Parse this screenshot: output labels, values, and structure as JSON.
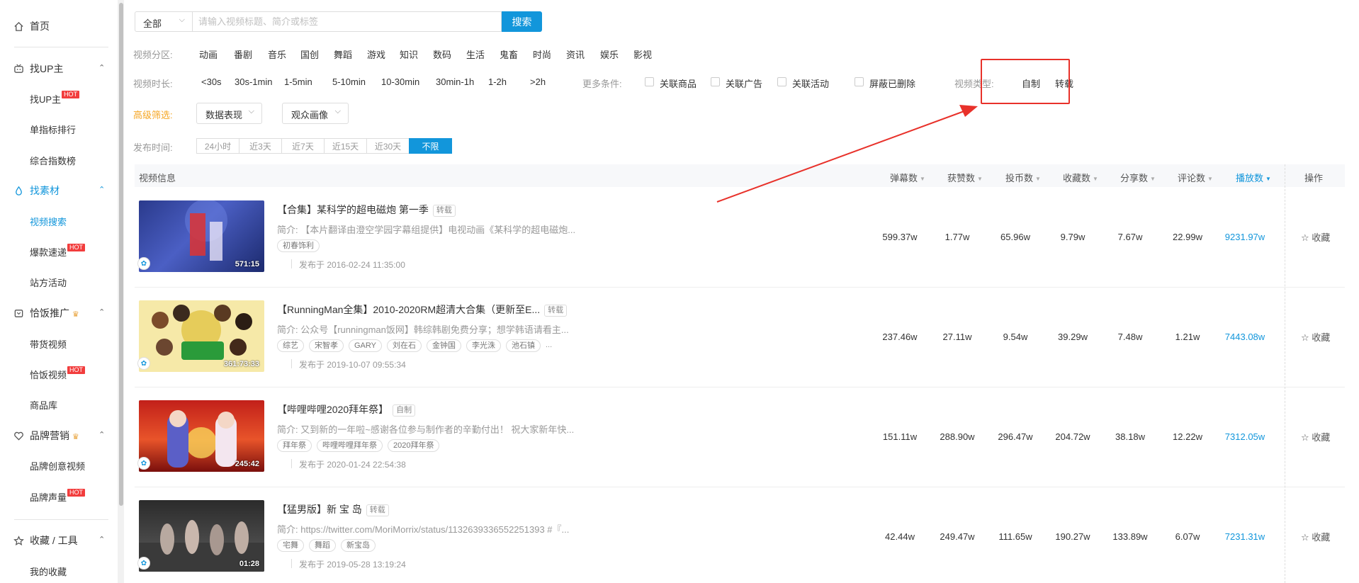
{
  "sidebar": {
    "home": "首页",
    "groups": [
      {
        "label": "找UP主",
        "items": [
          {
            "label": "找UP主",
            "hot": "HOT"
          },
          {
            "label": "单指标排行"
          },
          {
            "label": "综合指数榜"
          }
        ]
      },
      {
        "label": "找素材",
        "items": [
          {
            "label": "视频搜索"
          },
          {
            "label": "爆款速递",
            "hot": "HOT"
          },
          {
            "label": "站方活动"
          }
        ]
      },
      {
        "label": "恰饭推广",
        "items": [
          {
            "label": "带货视频"
          },
          {
            "label": "恰饭视频",
            "hot": "HOT"
          },
          {
            "label": "商品库"
          }
        ]
      },
      {
        "label": "品牌营销",
        "items": [
          {
            "label": "品牌创意视频"
          },
          {
            "label": "品牌声量",
            "hot": "HOT"
          }
        ]
      },
      {
        "label": "收藏 / 工具",
        "items": [
          {
            "label": "我的收藏"
          }
        ]
      }
    ]
  },
  "search": {
    "scope": "全部",
    "placeholder": "请输入视频标题、简介或标签",
    "button": "搜索"
  },
  "filters": {
    "category_label": "视频分区:",
    "categories": [
      "动画",
      "番剧",
      "音乐",
      "国创",
      "舞蹈",
      "游戏",
      "知识",
      "数码",
      "生活",
      "鬼畜",
      "时尚",
      "资讯",
      "娱乐",
      "影视"
    ],
    "duration_label": "视频时长:",
    "durations": [
      "<30s",
      "30s-1min",
      "1-5min",
      "5-10min",
      "10-30min",
      "30min-1h",
      "1-2h",
      ">2h"
    ],
    "more_label": "更多条件:",
    "more_options": [
      "关联商品",
      "关联广告",
      "关联活动",
      "屏蔽已删除"
    ],
    "type_label": "视频类型:",
    "types": [
      "自制",
      "转载"
    ],
    "advanced_label": "高级筛选:",
    "advanced_dropdowns": [
      "数据表现",
      "观众画像"
    ],
    "time_label": "发布时间:",
    "time_options": [
      "24小时",
      "近3天",
      "近7天",
      "近15天",
      "近30天",
      "不限"
    ],
    "time_selected": "不限"
  },
  "table": {
    "headers": {
      "info": "视频信息",
      "danmaku": "弹幕数",
      "likes": "获赞数",
      "coins": "投币数",
      "favorites": "收藏数",
      "shares": "分享数",
      "comments": "评论数",
      "plays": "播放数",
      "actions": "操作"
    },
    "fav_label": "收藏",
    "rows": [
      {
        "title": "【合集】某科学的超电磁炮 第一季",
        "tag": "转载",
        "desc": "简介: 【本片翻译由澄空学园字幕组提供】电视动画《某科学的超电磁炮...",
        "chips": [
          "初春饰利"
        ],
        "date": "发布于 2016-02-24 11:35:00",
        "duration": "571:15",
        "danmaku": "599.37w",
        "likes": "1.77w",
        "coins": "65.96w",
        "favorites": "9.79w",
        "shares": "7.67w",
        "comments": "22.99w",
        "plays": "9231.97w"
      },
      {
        "title": "【RunningMan全集】2010-2020RM超清大合集（更新至E...",
        "tag": "转载",
        "desc": "简介: 公众号【runningman饭网】韩综韩剧免费分享；想学韩语请看主...",
        "chips": [
          "综艺",
          "宋智孝",
          "GARY",
          "刘在石",
          "金钟国",
          "李光洙",
          "池石镇"
        ],
        "more": "...",
        "date": "发布于 2019-10-07 09:55:34",
        "duration": "361:73:33",
        "danmaku": "237.46w",
        "likes": "27.11w",
        "coins": "9.54w",
        "favorites": "39.29w",
        "shares": "7.48w",
        "comments": "1.21w",
        "plays": "7443.08w"
      },
      {
        "title": "【哔哩哔哩2020拜年祭】",
        "tag": "自制",
        "desc": "简介: 又到新的一年啦~感谢各位参与制作者的辛勤付出！ 祝大家新年快...",
        "chips": [
          "拜年祭",
          "哔哩哔哩拜年祭",
          "2020拜年祭"
        ],
        "date": "发布于 2020-01-24 22:54:38",
        "duration": "245:42",
        "danmaku": "151.11w",
        "likes": "288.90w",
        "coins": "296.47w",
        "favorites": "204.72w",
        "shares": "38.18w",
        "comments": "12.22w",
        "plays": "7312.05w"
      },
      {
        "title": "【猛男版】新 宝 岛",
        "tag": "转载",
        "desc": "简介: https://twitter.com/MoriMorrix/status/1132639336552251393 #『...",
        "chips": [
          "宅舞",
          "舞蹈",
          "新宝岛"
        ],
        "date": "发布于 2019-05-28 13:19:24",
        "duration": "01:28",
        "danmaku": "42.44w",
        "likes": "249.47w",
        "coins": "111.65w",
        "favorites": "190.27w",
        "shares": "133.89w",
        "comments": "6.07w",
        "plays": "7231.31w"
      }
    ]
  },
  "colors": {
    "accent": "#1296db",
    "hot": "#f23d3d",
    "annotation": "#e8312a",
    "advanced": "#f5a623"
  }
}
